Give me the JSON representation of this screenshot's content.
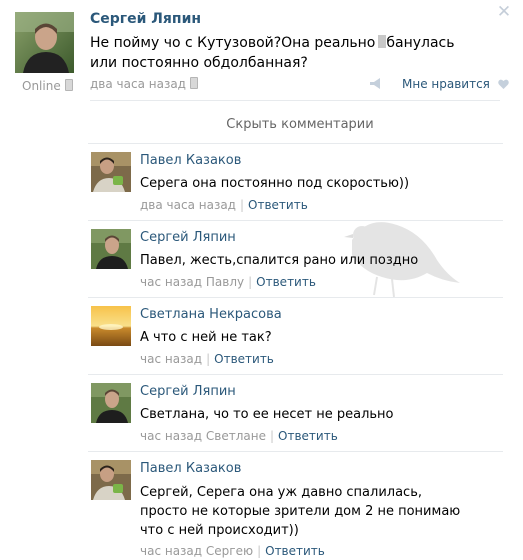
{
  "post": {
    "author": "Сергей Ляпин",
    "text_before": "Не пойму чо с Кутузовой?Она реально",
    "text_after": "бaнулась или постоянно обдолбанная?",
    "time": "два часа назад",
    "online": "Online",
    "like_label": "Мне нравится",
    "hide_comments": "Скрыть комментарии"
  },
  "comments": [
    {
      "author": "Павел Казаков",
      "text": "Серега она постоянно под скоростью))",
      "time": "два часа назад",
      "reply": "Ответить",
      "avatar": "avatar-pavel"
    },
    {
      "author": "Сергей Ляпин",
      "text": "Павел, жесть,спалится рано или поздно",
      "time": "час назад Павлу",
      "reply": "Ответить",
      "avatar": "avatar-sergey"
    },
    {
      "author": "Светлана Некрасова",
      "text": "А что с ней не так?",
      "time": "час назад",
      "reply": "Ответить",
      "avatar": "avatar-sunset"
    },
    {
      "author": "Сергей Ляпин",
      "text": "Светлана, чо то ее несет не реально",
      "time": "час назад Светлане",
      "reply": "Ответить",
      "avatar": "avatar-sergey"
    },
    {
      "author": "Павел Казаков",
      "text": "Сергей, Серега она уж давно спалилась, просто не которые зрители дом 2 не понимаю что с ней происходит))",
      "time": "час назад Сергею",
      "reply": "Ответить",
      "avatar": "avatar-pavel"
    }
  ],
  "colors": {
    "link": "#2b587a",
    "meta": "#999999",
    "separator": "#e7eaed"
  },
  "icons": [
    "close-icon",
    "mobile-icon",
    "share-icon",
    "heart-icon"
  ]
}
